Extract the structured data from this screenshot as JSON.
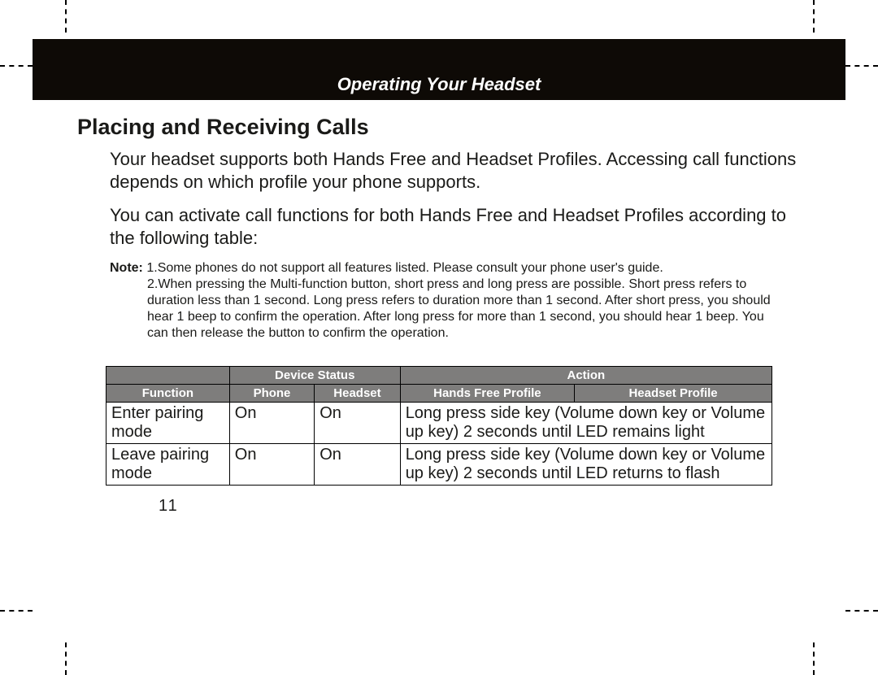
{
  "banner": {
    "title": "Operating Your Headset"
  },
  "section": {
    "title": "Placing and Receiving Calls",
    "para1": "Your headset supports both Hands Free and Headset Profiles. Accessing call functions depends on which profile your phone supports.",
    "para2": "You can activate call functions for both Hands Free and Headset Profiles according to the following table:"
  },
  "note": {
    "label": "Note:",
    "item1": "1.Some phones do not support all features listed. Please consult your phone user's guide.",
    "item2": "2.When pressing the Multi-function button, short press and long press are possible.  Short press refers to duration less than 1 second. Long press refers to duration more than 1 second.  After short press, you should hear 1 beep to confirm the operation.  After long press for more than 1 second, you should hear 1 beep.  You can then release the button to confirm the operation."
  },
  "chart_data": {
    "type": "table",
    "title": "Call function table",
    "header_row1": {
      "blank": "",
      "device_status": "Device Status",
      "action": "Action"
    },
    "header_row2": {
      "function": "Function",
      "phone": "Phone",
      "headset": "Headset",
      "hands_free_profile": "Hands Free Profile",
      "headset_profile": "Headset Profile"
    },
    "rows": [
      {
        "function": "Enter pairing mode",
        "phone": "On",
        "headset": "On",
        "action": "Long press side key (Volume down key or Volume up key) 2 seconds until LED remains light"
      },
      {
        "function": "Leave pairing mode",
        "phone": "On",
        "headset": "On",
        "action": "Long press side key (Volume down key or Volume up key) 2 seconds until LED returns to flash"
      }
    ]
  },
  "page_number": "11"
}
